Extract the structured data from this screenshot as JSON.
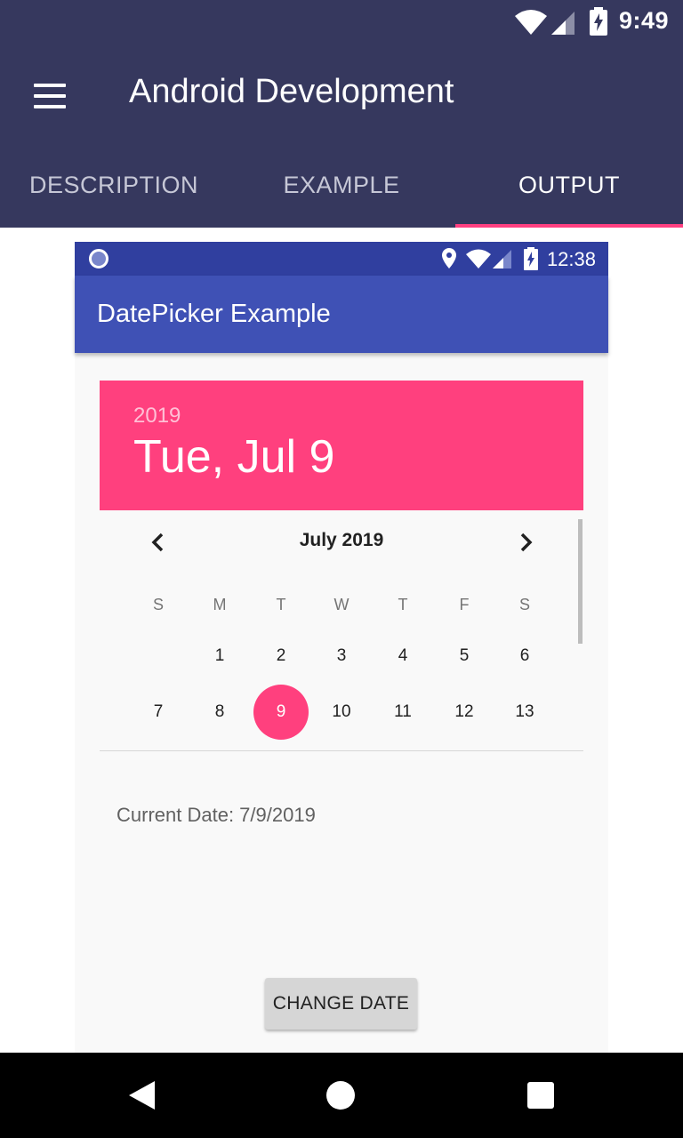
{
  "status_bar": {
    "time": "9:49",
    "icons": [
      "wifi-icon",
      "signal-icon",
      "battery-charging-icon"
    ]
  },
  "app_bar": {
    "title": "Android Development",
    "menu_icon": "hamburger-menu-icon"
  },
  "tabs": [
    {
      "label": "DESCRIPTION",
      "active": false
    },
    {
      "label": "EXAMPLE",
      "active": false
    },
    {
      "label": "OUTPUT",
      "active": true
    }
  ],
  "colors": {
    "primary_dark": "#36385e",
    "accent": "#ff4081",
    "inner_primary": "#3f51b5",
    "inner_primary_dark": "#303f9f",
    "picker_header": "#ff407e"
  },
  "inner": {
    "status_bar": {
      "time": "12:38",
      "icons": [
        "notification-dot-icon",
        "location-icon",
        "wifi-icon",
        "signal-icon",
        "battery-charging-icon"
      ]
    },
    "app_bar": {
      "title": "DatePicker Example"
    },
    "date_picker": {
      "year": "2019",
      "date": "Tue, Jul 9",
      "month_label": "July 2019",
      "weekdays": [
        "S",
        "M",
        "T",
        "W",
        "T",
        "F",
        "S"
      ],
      "weeks": [
        [
          "",
          "1",
          "2",
          "3",
          "4",
          "5",
          "6"
        ],
        [
          "7",
          "8",
          "9",
          "10",
          "11",
          "12",
          "13"
        ]
      ],
      "selected_day": "9"
    },
    "current_date": "Current Date: 7/9/2019",
    "change_button": "CHANGE DATE"
  },
  "nav_bar": {
    "icons": [
      "back-icon",
      "home-icon",
      "recents-icon"
    ]
  }
}
